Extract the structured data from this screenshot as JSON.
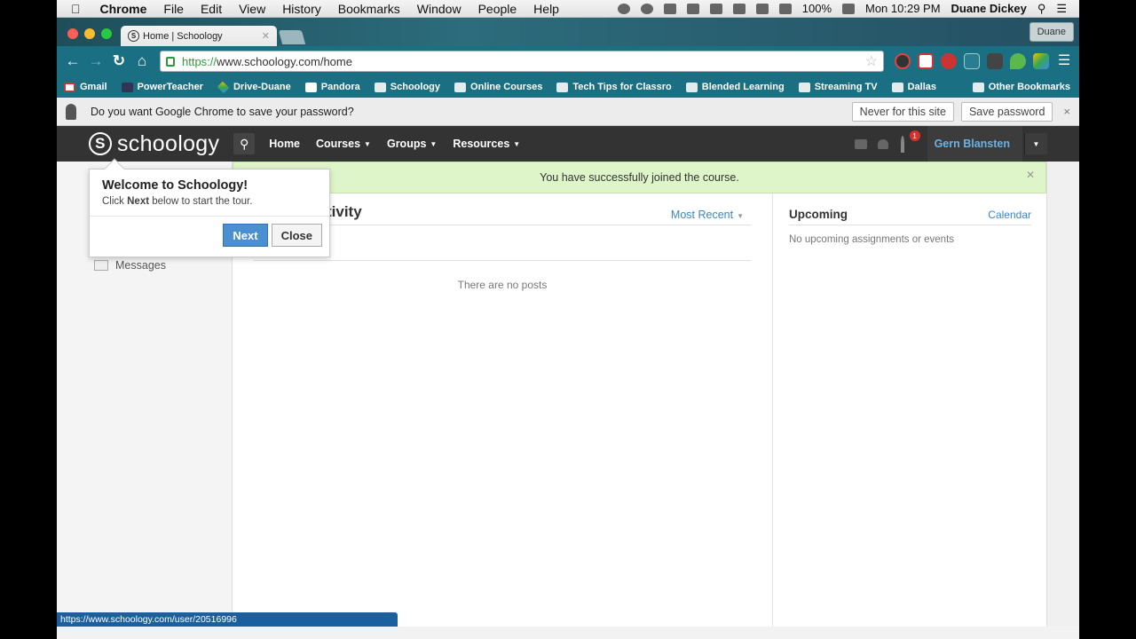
{
  "menubar": {
    "app": "Chrome",
    "items": [
      "File",
      "Edit",
      "View",
      "History",
      "Bookmarks",
      "Window",
      "People",
      "Help"
    ],
    "battery": "100%",
    "clock": "Mon 10:29 PM",
    "user": "Duane Dickey"
  },
  "browser": {
    "tab_title": "Home | Schoology",
    "tab_favicon": "S",
    "profile": "Duane",
    "url_scheme": "https://",
    "url_rest": "www.schoology.com/home"
  },
  "bookmarks": {
    "items": [
      {
        "label": "Gmail",
        "icon": "gmail-icon"
      },
      {
        "label": "PowerTeacher",
        "icon": "powerteacher-icon"
      },
      {
        "label": "Drive-Duane",
        "icon": "drive-icon"
      },
      {
        "label": "Pandora",
        "icon": "pandora-icon"
      },
      {
        "label": "Schoology",
        "icon": "folder-icon"
      },
      {
        "label": "Online Courses",
        "icon": "folder-icon"
      },
      {
        "label": "Tech Tips for Classro",
        "icon": "folder-icon"
      },
      {
        "label": "Blended Learning",
        "icon": "folder-icon"
      },
      {
        "label": "Streaming TV",
        "icon": "folder-icon"
      },
      {
        "label": "Dallas",
        "icon": "folder-icon"
      }
    ],
    "other": "Other Bookmarks"
  },
  "infobar": {
    "message": "Do you want Google Chrome to save your password?",
    "never_label": "Never for this site",
    "save_label": "Save password",
    "close": "×"
  },
  "schoology": {
    "logo": "schoology",
    "nav": [
      {
        "label": "Home",
        "caret": false
      },
      {
        "label": "Courses",
        "caret": true
      },
      {
        "label": "Groups",
        "caret": true
      },
      {
        "label": "Resources",
        "caret": true
      }
    ],
    "notification_count": "1",
    "user": "Gern Blansten"
  },
  "page": {
    "banner": "You have successfully joined the course.",
    "feed_title": "Recent Activity",
    "feed_title_visible": "tivity",
    "sort": "Most Recent",
    "post_link_visible": "t",
    "no_posts": "There are no posts",
    "sidebar_messages": "Messages",
    "upcoming_title": "Upcoming",
    "calendar_link": "Calendar",
    "upcoming_empty": "No upcoming assignments or events"
  },
  "tour": {
    "title": "Welcome to Schoology!",
    "text_before": "Click ",
    "text_bold": "Next",
    "text_after": " below to start the tour.",
    "next_label": "Next",
    "close_label": "Close"
  },
  "status_url": "https://www.schoology.com/user/20516996",
  "colors": {
    "chrome_teal": "#1b6f83",
    "schoology_header": "#333333",
    "banner_green": "#def5c9",
    "link_blue": "#3a87c4",
    "next_button": "#4a8fd0"
  }
}
